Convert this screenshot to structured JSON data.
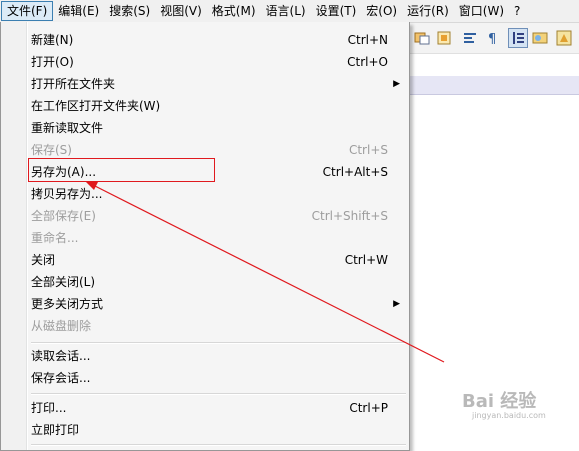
{
  "menubar": {
    "items": [
      "文件(F)",
      "编辑(E)",
      "搜索(S)",
      "视图(V)",
      "格式(M)",
      "语言(L)",
      "设置(T)",
      "宏(O)",
      "运行(R)",
      "窗口(W)",
      "?"
    ]
  },
  "file_menu": {
    "group1": [
      {
        "label": "新建(N)",
        "shortcut": "Ctrl+N"
      },
      {
        "label": "打开(O)",
        "shortcut": "Ctrl+O"
      },
      {
        "label": "打开所在文件夹",
        "shortcut": ""
      },
      {
        "label": "在工作区打开文件夹(W)",
        "shortcut": ""
      },
      {
        "label": "重新读取文件",
        "shortcut": ""
      },
      {
        "label": "保存(S)",
        "shortcut": "Ctrl+S"
      },
      {
        "label": "另存为(A)...",
        "shortcut": "Ctrl+Alt+S"
      },
      {
        "label": "拷贝另存为...",
        "shortcut": ""
      },
      {
        "label": "全部保存(E)",
        "shortcut": "Ctrl+Shift+S"
      },
      {
        "label": "重命名...",
        "shortcut": ""
      },
      {
        "label": "关闭",
        "shortcut": "Ctrl+W"
      },
      {
        "label": "全部关闭(L)",
        "shortcut": ""
      },
      {
        "label": "更多关闭方式",
        "shortcut": ""
      },
      {
        "label": "从磁盘删除",
        "shortcut": ""
      }
    ],
    "group2": [
      {
        "label": "读取会话...",
        "shortcut": ""
      },
      {
        "label": "保存会话...",
        "shortcut": ""
      }
    ],
    "group3": [
      {
        "label": "打印...",
        "shortcut": "Ctrl+P"
      },
      {
        "label": "立即打印",
        "shortcut": ""
      }
    ]
  },
  "watermark": {
    "brand": "Bai 经验",
    "url": "jingyan.baidu.com"
  },
  "colors": {
    "annotation_red": "#e0191e",
    "disabled_text": "#9d9d9d",
    "menu_bg": "#f5f5f5"
  }
}
